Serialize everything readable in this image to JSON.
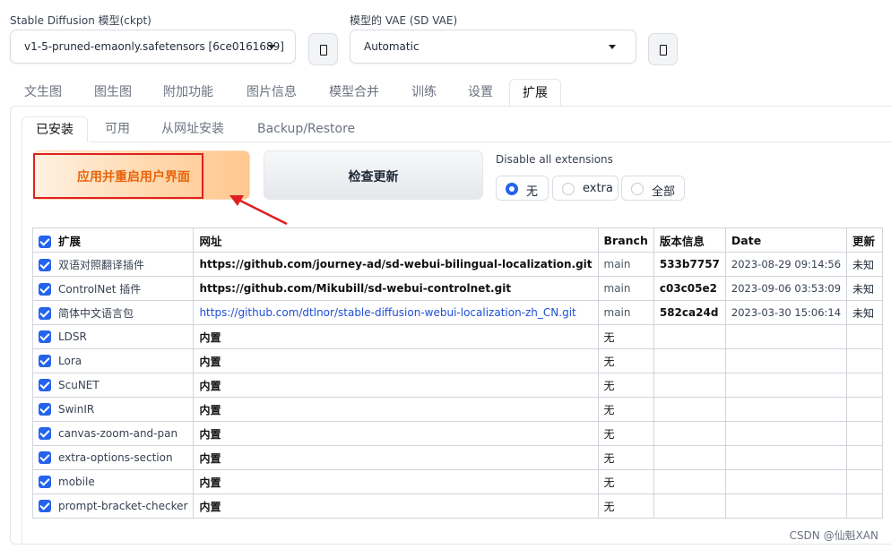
{
  "checkpoint": {
    "label": "Stable Diffusion 模型(ckpt)",
    "value": "v1-5-pruned-emaonly.safetensors [6ce0161689]"
  },
  "vae": {
    "label": "模型的 VAE (SD VAE)",
    "value": "Automatic"
  },
  "main_tabs": [
    "文生图",
    "图生图",
    "附加功能",
    "图片信息",
    "模型合并",
    "训练",
    "设置",
    "扩展"
  ],
  "sub_tabs": [
    "已安装",
    "可用",
    "从网址安装",
    "Backup/Restore"
  ],
  "apply_button": "应用并重启用户界面",
  "check_button": "检查更新",
  "disable_label": "Disable all extensions",
  "radio_options": [
    "无",
    "extra",
    "全部"
  ],
  "table": {
    "headers": [
      "扩展",
      "网址",
      "Branch",
      "版本信息",
      "Date",
      "更新"
    ],
    "rows": [
      {
        "name": "双语对照翻译插件",
        "url": "https://github.com/journey-ad/sd-webui-bilingual-localization.git",
        "branch": "main",
        "version": "533b7757",
        "date": "2023-08-29 09:14:56",
        "update": "未知"
      },
      {
        "name": "ControlNet 插件",
        "url": "https://github.com/Mikubill/sd-webui-controlnet.git",
        "branch": "main",
        "version": "c03c05e2",
        "date": "2023-09-06 03:53:09",
        "update": "未知"
      },
      {
        "name": "简体中文语言包",
        "url": "https://github.com/dtlnor/stable-diffusion-webui-localization-zh_CN.git",
        "branch": "main",
        "version": "582ca24d",
        "date": "2023-03-30 15:06:14",
        "update": "未知"
      },
      {
        "name": "LDSR",
        "url": "内置",
        "branch": "无",
        "version": "",
        "date": "",
        "update": ""
      },
      {
        "name": "Lora",
        "url": "内置",
        "branch": "无",
        "version": "",
        "date": "",
        "update": ""
      },
      {
        "name": "ScuNET",
        "url": "内置",
        "branch": "无",
        "version": "",
        "date": "",
        "update": ""
      },
      {
        "name": "SwinIR",
        "url": "内置",
        "branch": "无",
        "version": "",
        "date": "",
        "update": ""
      },
      {
        "name": "canvas-zoom-and-pan",
        "url": "内置",
        "branch": "无",
        "version": "",
        "date": "",
        "update": ""
      },
      {
        "name": "extra-options-section",
        "url": "内置",
        "branch": "无",
        "version": "",
        "date": "",
        "update": ""
      },
      {
        "name": "mobile",
        "url": "内置",
        "branch": "无",
        "version": "",
        "date": "",
        "update": ""
      },
      {
        "name": "prompt-bracket-checker",
        "url": "内置",
        "branch": "无",
        "version": "",
        "date": "",
        "update": ""
      }
    ]
  },
  "watermark": "CSDN @仙魁XAN",
  "colors": {
    "accent": "#2563eb",
    "apply_text": "#e8640a",
    "annotation": "#e02020"
  }
}
